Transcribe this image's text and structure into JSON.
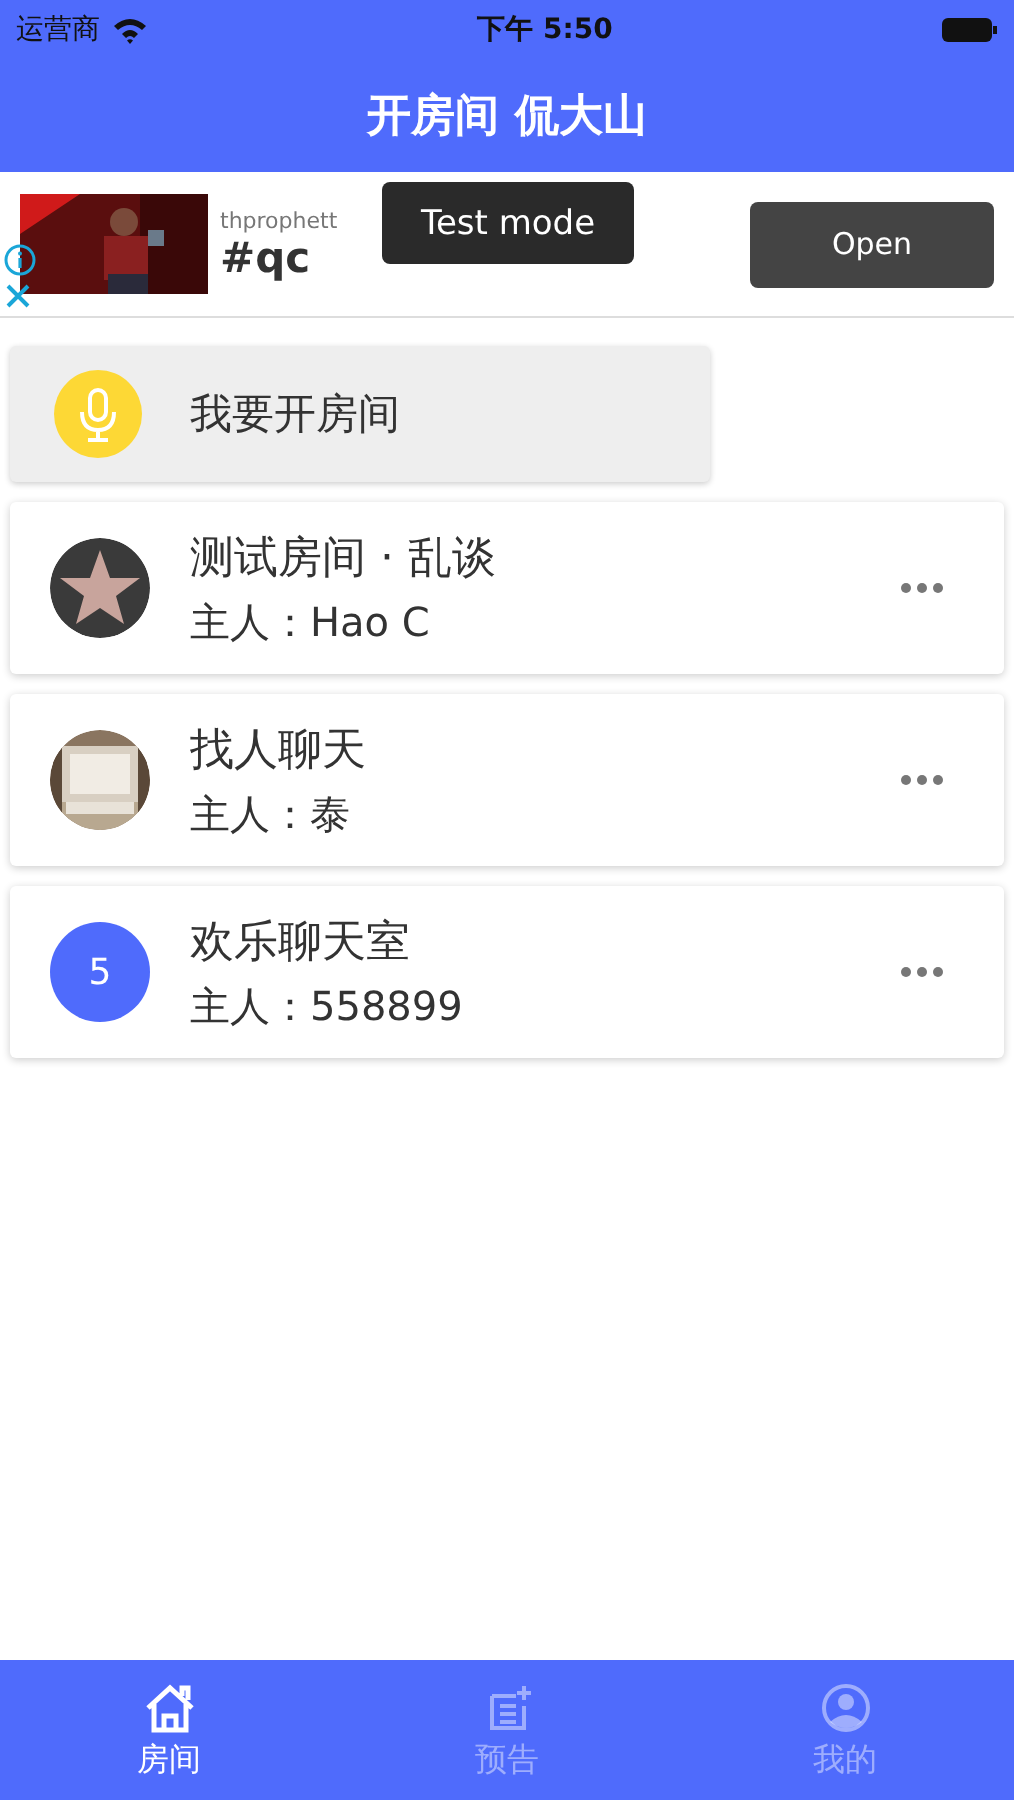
{
  "status_bar": {
    "carrier": "运营商",
    "time": "下午 5:50"
  },
  "header": {
    "title": "开房间 侃大山"
  },
  "ad": {
    "advertiser": "thprophett",
    "headline": "#qc",
    "toast": "Test mode",
    "button": "Open"
  },
  "create_room": {
    "label": "我要开房间"
  },
  "rooms": [
    {
      "kind": "star",
      "title": "测试房间 · 乱谈",
      "host_label": "主人：",
      "host": "Hao C"
    },
    {
      "title": "找人聊天",
      "host_label": "主人：",
      "host": "泰"
    },
    {
      "kind": "number",
      "avatar_text": "5",
      "title": "欢乐聊天室",
      "host_label": "主人：",
      "host": "558899"
    }
  ],
  "tabs": [
    {
      "kind": "home",
      "label": "房间",
      "selected": true
    },
    {
      "kind": "notice",
      "label": "预告",
      "selected": false
    },
    {
      "kind": "profile",
      "label": "我的",
      "selected": false
    }
  ]
}
